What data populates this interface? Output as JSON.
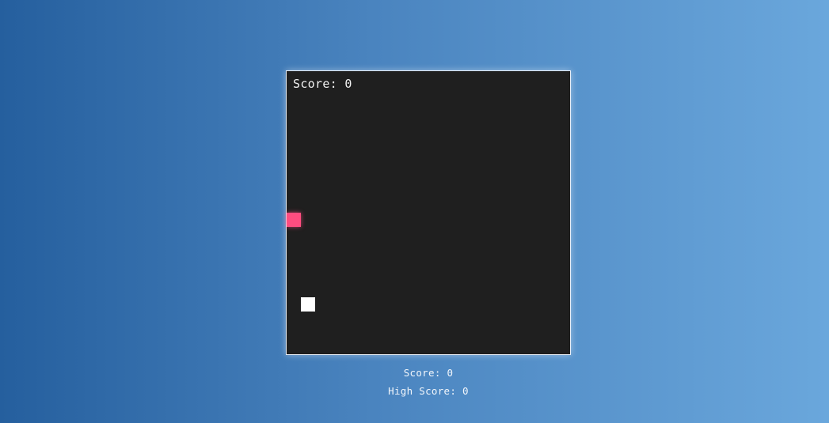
{
  "board": {
    "score_label": "Score: 0"
  },
  "stats": {
    "score_label": "Score: 0",
    "high_score_label": "High Score: 0"
  },
  "colors": {
    "background_start": "#255f9e",
    "background_end": "#6aa7dc",
    "board": "#1f1f1f",
    "food": "#ff4d80",
    "snake": "#ffffff"
  },
  "icons": {
    "food": "food-square-icon",
    "snake": "snake-segment-icon"
  }
}
